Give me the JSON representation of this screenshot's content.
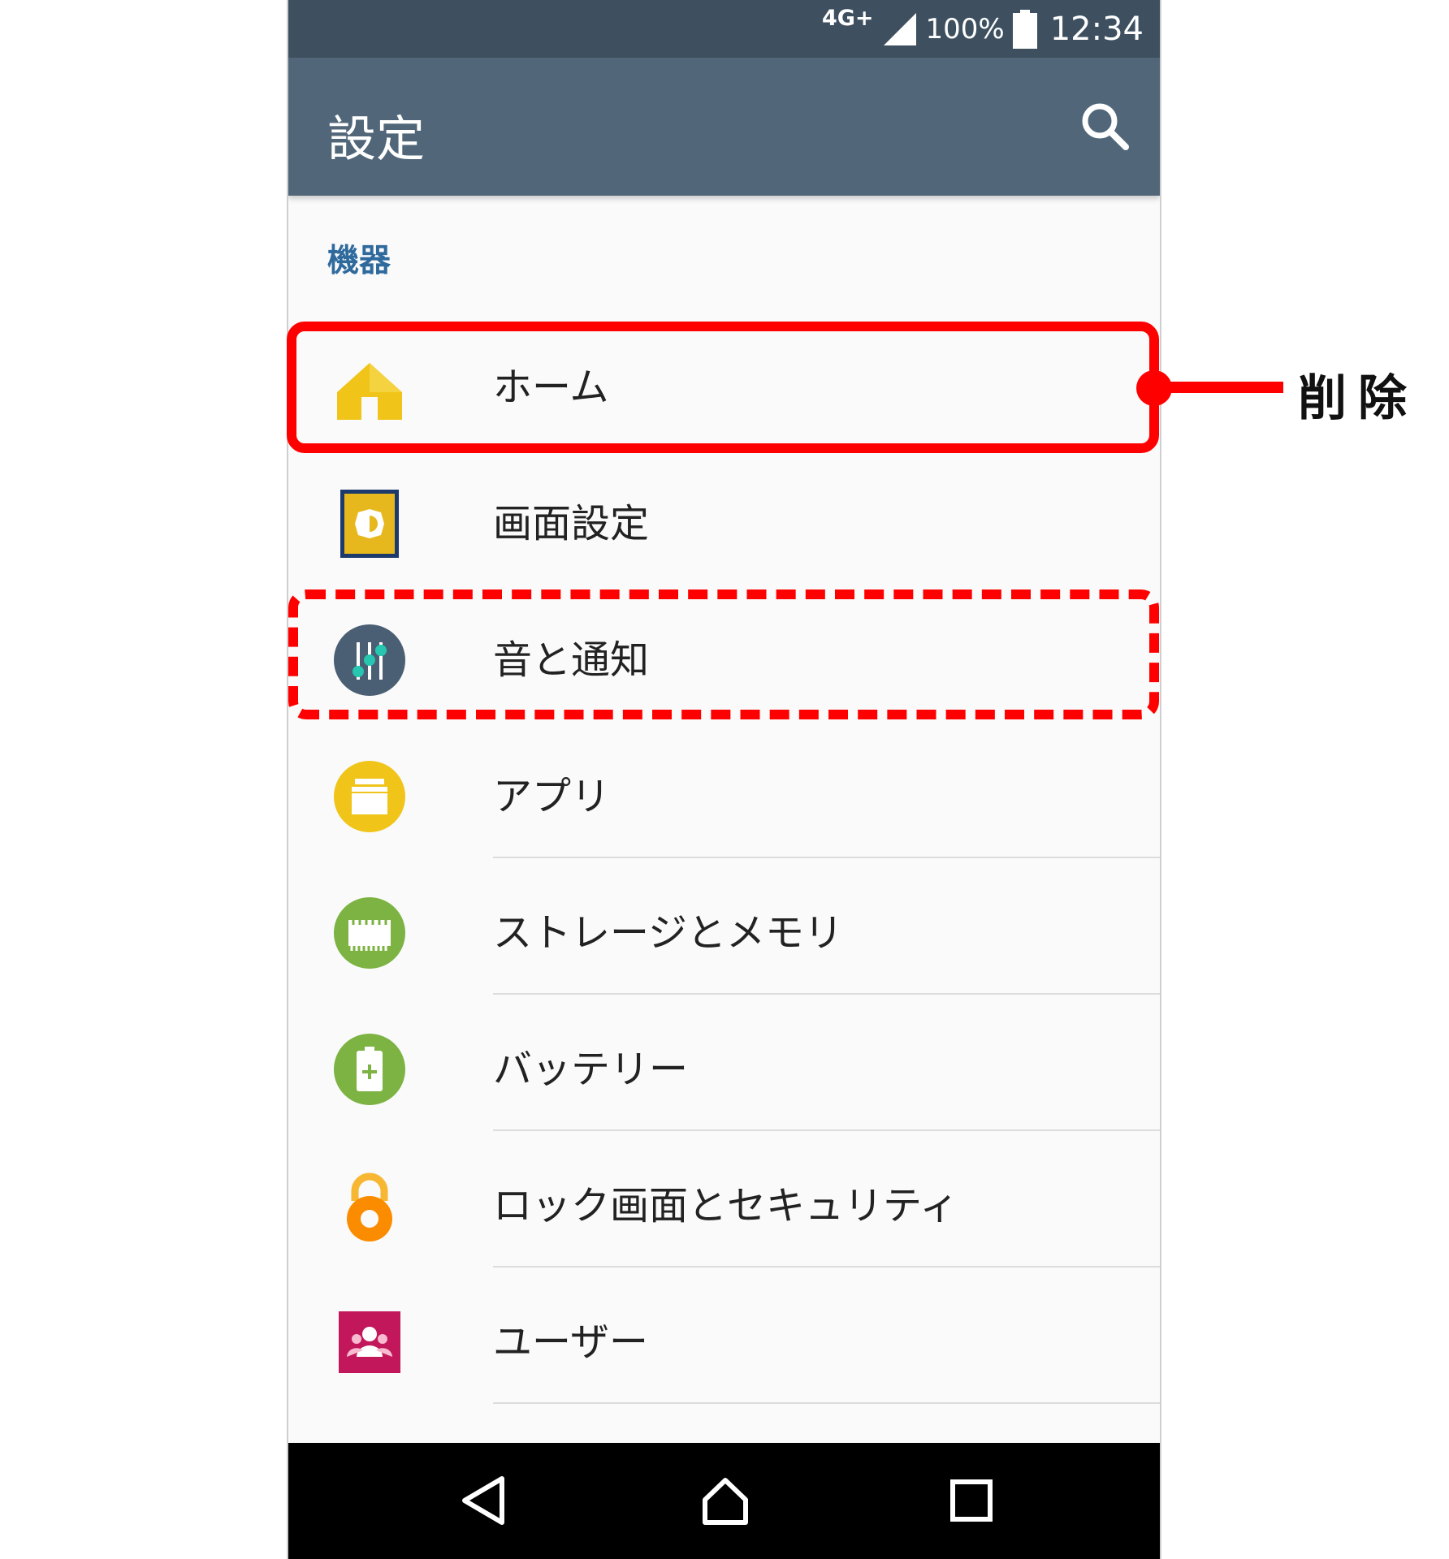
{
  "status_bar": {
    "network": "4G+",
    "battery": "100%",
    "time": "12:34"
  },
  "app_bar": {
    "title": "設定",
    "search_icon": "search-icon"
  },
  "section": {
    "title": "機器"
  },
  "items": [
    {
      "label": "ホーム",
      "icon": "home-icon",
      "color": "#f0c419"
    },
    {
      "label": "画面設定",
      "icon": "display-brightness-icon",
      "color": "#e8b800"
    },
    {
      "label": "音と通知",
      "icon": "sound-sliders-icon",
      "color": "#4a5f73"
    },
    {
      "label": "アプリ",
      "icon": "apps-icon",
      "color": "#f0c419"
    },
    {
      "label": "ストレージとメモリ",
      "icon": "memory-chip-icon",
      "color": "#7cb342"
    },
    {
      "label": "バッテリー",
      "icon": "battery-icon",
      "color": "#7cb342"
    },
    {
      "label": "ロック画面とセキュリティ",
      "icon": "padlock-icon",
      "color": "#ff9800"
    },
    {
      "label": "ユーザー",
      "icon": "users-icon",
      "color": "#c2185b"
    }
  ],
  "nav_bar": {
    "back": "back-icon",
    "home": "home-nav-icon",
    "recents": "recents-icon"
  },
  "annotation": {
    "label": "削除",
    "highlight_color": "#ff0000"
  }
}
